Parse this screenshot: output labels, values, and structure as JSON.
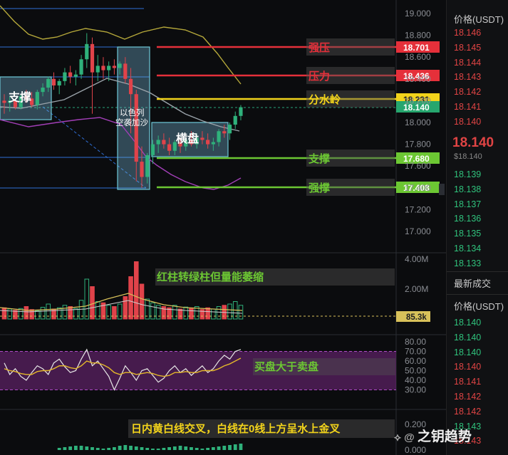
{
  "chart_data": {
    "type": "candlestick",
    "price_axis": {
      "ticks": [
        "19.000",
        "18.800",
        "18.600",
        "18.400",
        "18.200",
        "18.000",
        "17.800",
        "17.600",
        "17.400",
        "17.200",
        "17.000"
      ]
    },
    "candles": [
      [
        18.2,
        18.26,
        18.08,
        18.18
      ],
      [
        18.18,
        18.24,
        18.1,
        18.2
      ],
      [
        18.2,
        18.22,
        18.12,
        18.14
      ],
      [
        18.14,
        18.26,
        18.12,
        18.24
      ],
      [
        18.24,
        18.3,
        18.18,
        18.22
      ],
      [
        18.22,
        18.28,
        18.14,
        18.16
      ],
      [
        18.16,
        18.3,
        18.12,
        18.28
      ],
      [
        18.28,
        18.36,
        18.24,
        18.32
      ],
      [
        18.32,
        18.42,
        18.28,
        18.4
      ],
      [
        18.4,
        18.46,
        18.3,
        18.34
      ],
      [
        18.34,
        18.4,
        18.26,
        18.38
      ],
      [
        18.38,
        18.5,
        18.34,
        18.46
      ],
      [
        18.46,
        18.52,
        18.36,
        18.42
      ],
      [
        18.42,
        18.48,
        18.34,
        18.44
      ],
      [
        18.44,
        18.62,
        18.4,
        18.58
      ],
      [
        18.58,
        18.82,
        18.5,
        18.72
      ],
      [
        18.72,
        18.78,
        18.08,
        18.46
      ],
      [
        18.46,
        18.62,
        18.38,
        18.52
      ],
      [
        18.52,
        18.6,
        18.4,
        18.48
      ],
      [
        18.48,
        18.56,
        18.38,
        18.52
      ],
      [
        18.52,
        18.58,
        18.44,
        18.5
      ],
      [
        18.5,
        18.56,
        18.44,
        18.54
      ],
      [
        18.54,
        18.6,
        18.36,
        18.4
      ],
      [
        18.4,
        18.5,
        17.9,
        18.26
      ],
      [
        18.26,
        18.3,
        17.46,
        17.64
      ],
      [
        17.64,
        17.78,
        17.4,
        17.5
      ],
      [
        17.5,
        17.72,
        17.44,
        17.7
      ],
      [
        17.7,
        17.84,
        17.62,
        17.8
      ],
      [
        17.8,
        17.88,
        17.72,
        17.84
      ],
      [
        17.84,
        17.9,
        17.76,
        17.8
      ],
      [
        17.8,
        17.86,
        17.7,
        17.74
      ],
      [
        17.74,
        17.84,
        17.7,
        17.82
      ],
      [
        17.82,
        17.86,
        17.72,
        17.78
      ],
      [
        17.78,
        17.86,
        17.74,
        17.84
      ],
      [
        17.84,
        17.92,
        17.78,
        17.8
      ],
      [
        17.8,
        17.9,
        17.76,
        17.86
      ],
      [
        17.86,
        17.92,
        17.8,
        17.84
      ],
      [
        17.84,
        17.9,
        17.76,
        17.8
      ],
      [
        17.8,
        17.86,
        17.74,
        17.82
      ],
      [
        17.82,
        17.94,
        17.78,
        17.92
      ],
      [
        17.92,
        17.98,
        17.86,
        17.9
      ],
      [
        17.9,
        18.0,
        17.84,
        17.98
      ],
      [
        17.98,
        18.1,
        17.94,
        18.06
      ],
      [
        18.06,
        18.16,
        18.02,
        18.14
      ]
    ],
    "levels": [
      {
        "label": "强压",
        "price": "18.701",
        "color": "#e5303a"
      },
      {
        "label": "压力",
        "price": "18.436",
        "color": "#e5303a"
      },
      {
        "label": "分水岭",
        "price": "18.231",
        "color": "#f2d31b"
      },
      {
        "label": "",
        "price": "18.140",
        "color": "#26a66e"
      },
      {
        "label": "支撑",
        "price": "17.680",
        "color": "#6cc733"
      },
      {
        "label": "强撑",
        "price": "17.408",
        "color": "#6cc733"
      }
    ],
    "box_labels": [
      "支撑",
      "以色列\n空袭加沙",
      "横盘"
    ],
    "volume": {
      "axis": [
        "4.00M",
        "2.00M"
      ],
      "current": "85.3k",
      "values": [
        0.45,
        0.4,
        0.35,
        0.42,
        0.5,
        0.38,
        0.33,
        0.47,
        0.6,
        0.4,
        0.45,
        0.55,
        0.5,
        0.42,
        0.75,
        1.6,
        1.3,
        0.7,
        0.65,
        0.55,
        0.5,
        0.6,
        0.9,
        1.7,
        2.3,
        1.4,
        0.8,
        0.65,
        0.55,
        0.5,
        0.45,
        0.55,
        0.4,
        0.48,
        0.42,
        0.5,
        0.38,
        0.45,
        0.4,
        0.5,
        0.55,
        0.6,
        0.7,
        0.55
      ]
    },
    "oscillator": {
      "axis": [
        "80.00",
        "70.00",
        "60.00",
        "50.00",
        "40.00",
        "30.00"
      ],
      "white": [
        58,
        46,
        52,
        44,
        40,
        48,
        55,
        52,
        46,
        58,
        62,
        54,
        48,
        50,
        62,
        72,
        55,
        60,
        52,
        44,
        30,
        42,
        55,
        48,
        40,
        50,
        52,
        45,
        38,
        42,
        50,
        55,
        48,
        52,
        45,
        50,
        55,
        48,
        52,
        60,
        66,
        62,
        70,
        72
      ],
      "yellow": [
        52,
        50,
        49,
        47,
        46,
        46,
        49,
        50,
        50,
        52,
        55,
        55,
        53,
        52,
        55,
        60,
        58,
        58,
        56,
        53,
        48,
        46,
        48,
        48,
        46,
        47,
        48,
        47,
        45,
        44,
        45,
        48,
        48,
        49,
        48,
        48,
        50,
        50,
        50,
        52,
        55,
        57,
        60,
        63
      ]
    },
    "macd_axis": [
      "0.200",
      "0.000"
    ]
  },
  "annotations": {
    "box1": "支撑",
    "box2": "以色列\n空袭加沙",
    "box3": "横盘",
    "volume_note": "红柱转绿柱但量能萎缩",
    "osc_note": "买盘大于卖盘",
    "macd_note": "日内黄白线交叉，白线在0线上方呈水上金叉"
  },
  "orderbook": {
    "header": "价格(USDT)",
    "asks": [
      "18.146",
      "18.145",
      "18.144",
      "18.143",
      "18.142",
      "18.141",
      "18.140"
    ],
    "last_price": "18.140",
    "last_price_sub": "$18.140",
    "bids": [
      "18.139",
      "18.138",
      "18.137",
      "18.136",
      "18.135",
      "18.134",
      "18.133"
    ],
    "trades_title": "最新成交",
    "trades_header": "价格(USDT)",
    "trades": [
      {
        "p": "18.140",
        "c": "green"
      },
      {
        "p": "18.140",
        "c": "green"
      },
      {
        "p": "18.140",
        "c": "green"
      },
      {
        "p": "18.140",
        "c": "red"
      },
      {
        "p": "18.141",
        "c": "red"
      },
      {
        "p": "18.142",
        "c": "red"
      },
      {
        "p": "18.142",
        "c": "red"
      },
      {
        "p": "18.143",
        "c": "green"
      },
      {
        "p": "18.143",
        "c": "red"
      }
    ]
  },
  "watermark": "之钥趋势"
}
